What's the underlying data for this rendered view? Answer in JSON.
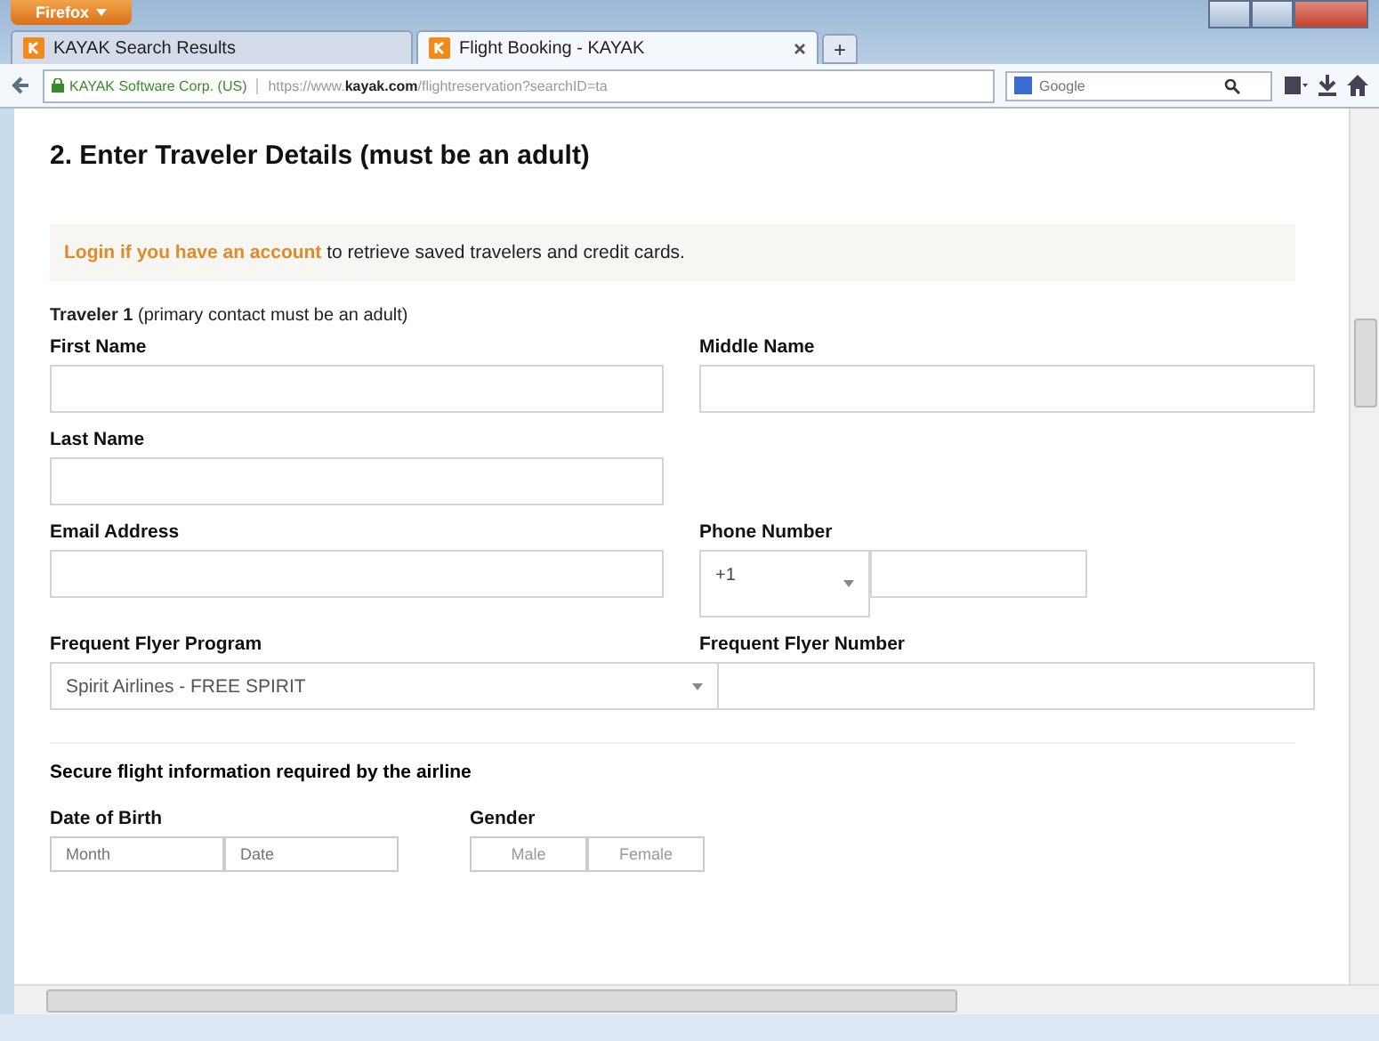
{
  "browser": {
    "menu_button": "Firefox",
    "tabs": [
      {
        "title": "KAYAK Search Results",
        "selected": false
      },
      {
        "title": "Flight Booking - KAYAK",
        "selected": true
      }
    ],
    "new_tab": "+",
    "address": {
      "identity": "KAYAK Software Corp. (US)",
      "url_prefix": "https://www.",
      "url_domain": "kayak.com",
      "url_rest": "/flightreservation?searchID=ta"
    },
    "search": {
      "placeholder": "Google"
    }
  },
  "page": {
    "heading": "2. Enter Traveler Details (must be an adult)",
    "login_notice": {
      "link": "Login if you have an account",
      "text": "to retrieve saved travelers and credit cards."
    },
    "traveler": {
      "title": "Traveler 1",
      "note": "(primary contact must be an adult)"
    },
    "rows": [
      [
        {
          "kind": "text",
          "label": "First Name"
        },
        {
          "kind": "text",
          "label": "Middle Name"
        }
      ],
      [
        {
          "kind": "text",
          "label": "Last Name"
        }
      ],
      [
        {
          "kind": "text",
          "label": "Email Address"
        },
        {
          "kind": "phone",
          "label": "Phone Number",
          "code": "+1"
        }
      ],
      [
        {
          "kind": "select",
          "label": "Frequent Flyer Program",
          "value": "Spirit Airlines - FREE SPIRIT"
        },
        {
          "kind": "text",
          "label": "Frequent Flyer Number"
        }
      ]
    ],
    "secure": {
      "title": "Secure flight information required by the airline",
      "dob": {
        "label": "Date of Birth",
        "placeholders": [
          "Month",
          "Date"
        ]
      },
      "gender": {
        "label": "Gender",
        "options": [
          {
            "label": "Male",
            "selected": false
          },
          {
            "label": "Female",
            "selected": false
          }
        ]
      }
    }
  }
}
